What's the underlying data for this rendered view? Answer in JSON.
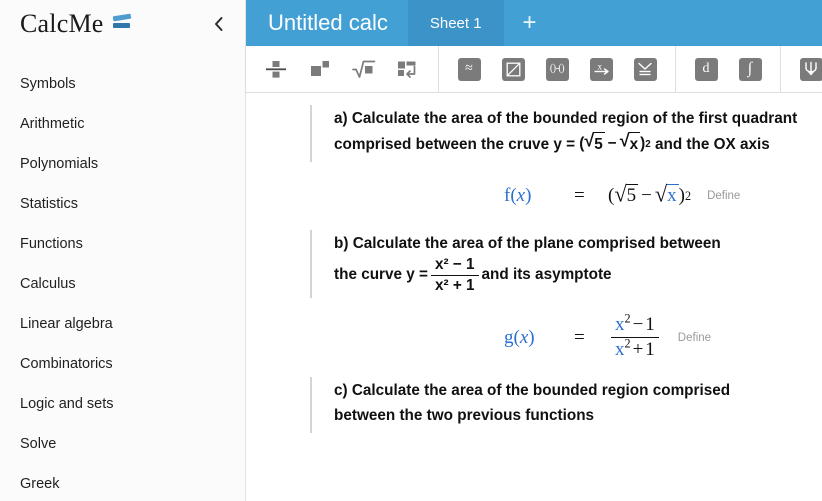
{
  "sidebar": {
    "brand": "CalcMe",
    "logo_icon": "calcme-logo-icon",
    "collapse_icon": "chevron-left-icon",
    "items": [
      {
        "label": "Symbols"
      },
      {
        "label": "Arithmetic"
      },
      {
        "label": "Polynomials"
      },
      {
        "label": "Statistics"
      },
      {
        "label": "Functions"
      },
      {
        "label": "Calculus"
      },
      {
        "label": "Linear algebra"
      },
      {
        "label": "Combinatorics"
      },
      {
        "label": "Logic and sets"
      },
      {
        "label": "Solve"
      },
      {
        "label": "Greek"
      }
    ]
  },
  "header": {
    "title": "Untitled calc",
    "tabs": [
      {
        "label": "Sheet 1",
        "active": true
      }
    ],
    "add_tab_label": "+",
    "background_color": "#43a0d5",
    "active_tab_color": "#3b93c8"
  },
  "toolbar": {
    "groups": [
      {
        "buttons": [
          {
            "name": "fraction-icon",
            "title": "Fraction"
          },
          {
            "name": "superscript-icon",
            "title": "Power"
          },
          {
            "name": "square-root-icon",
            "title": "Square root"
          },
          {
            "name": "matrix-newline-icon",
            "title": "Matrix"
          }
        ]
      },
      {
        "buttons": [
          {
            "name": "approximately-equal-icon",
            "title": "Approximate",
            "glyph": "≈"
          },
          {
            "name": "evaluate-slash-icon",
            "title": "Evaluate"
          },
          {
            "name": "interval-icon",
            "title": "Interval",
            "glyph": "()-()"
          },
          {
            "name": "solve-x-icon",
            "title": "Solve for x",
            "glyph": "x"
          },
          {
            "name": "check-list-icon",
            "title": "Check"
          }
        ]
      },
      {
        "buttons": [
          {
            "name": "derivative-icon",
            "title": "Derivative",
            "glyph": "d"
          },
          {
            "name": "integral-icon",
            "title": "Integral",
            "glyph": "∫"
          }
        ]
      },
      {
        "buttons": [
          {
            "name": "limit-icon",
            "title": "Limit"
          }
        ]
      }
    ]
  },
  "content": {
    "blocks": [
      {
        "kind": "text",
        "id": "problem-a",
        "line1_prefix": "a) Calculate the area of the bounded region of the first quadrant",
        "line2_prefix": "comprised between the cruve y =",
        "line2_suffix": "and the OX axis",
        "radicand1": "5",
        "radicand2": "x",
        "minus": "−",
        "exponent": "2"
      },
      {
        "kind": "definition",
        "id": "define-f",
        "name": "f",
        "arg": "x",
        "equals": "=",
        "define_label": "Define",
        "expr": {
          "type": "power-of-sqrt-difference",
          "radicand1": "5",
          "radicand2": "x",
          "minus": "−",
          "exponent": "2"
        }
      },
      {
        "kind": "text",
        "id": "problem-b",
        "line1_prefix": "b) Calculate the area of the plane comprised between",
        "line2_prefix": "the curve y =",
        "line2_suffix": "and its asymptote",
        "numerator": "x² − 1",
        "denominator": "x² + 1"
      },
      {
        "kind": "definition",
        "id": "define-g",
        "name": "g",
        "arg": "x",
        "equals": "=",
        "define_label": "Define",
        "expr": {
          "type": "fraction",
          "num_var": "x",
          "num_exp": "2",
          "num_op": "−",
          "num_const": "1",
          "den_var": "x",
          "den_exp": "2",
          "den_op": "+",
          "den_const": "1"
        }
      },
      {
        "kind": "text",
        "id": "problem-c",
        "line1_prefix": "c) Calculate the area of the bounded region comprised",
        "line2_prefix": "between the two previous functions",
        "line2_suffix": ""
      }
    ]
  }
}
